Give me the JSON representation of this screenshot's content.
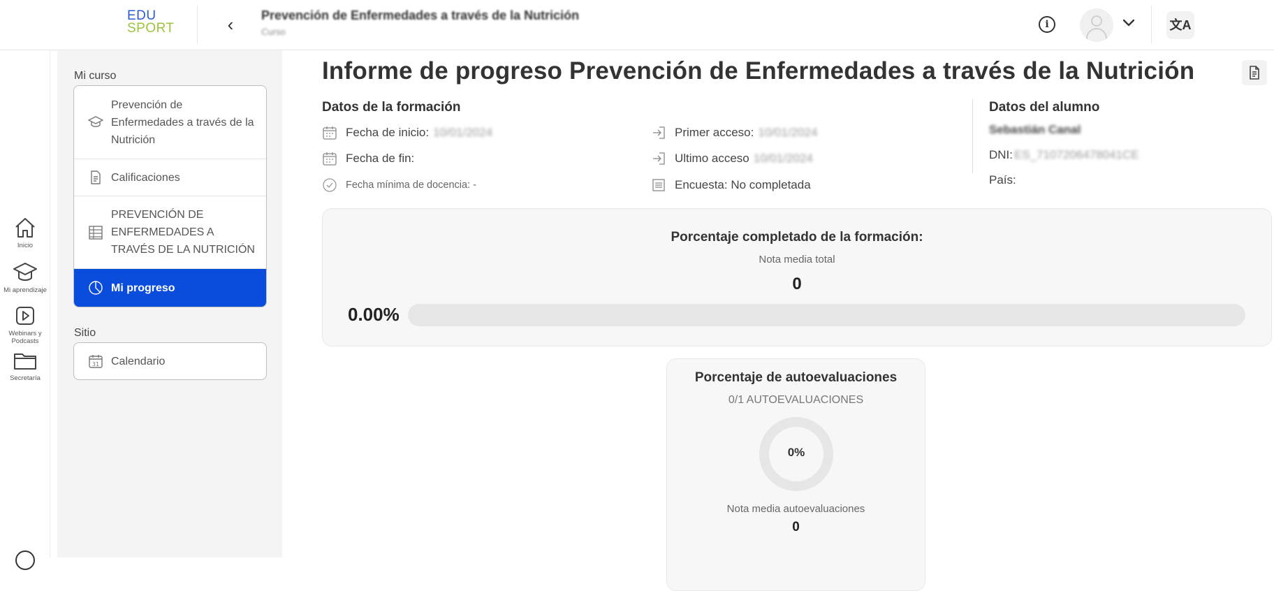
{
  "header": {
    "logo_line1": "EDU",
    "logo_line2": "SPORT",
    "course_title": "Prevención de Enfermedades a través de la Nutrición",
    "course_subtitle": "Curso",
    "info_icon": "info-icon",
    "avatar_icon": "user-avatar-icon",
    "menu_icon": "chevron-down-icon",
    "translate_icon": "translate-icon",
    "translate_glyph": "文A"
  },
  "left_nav": {
    "items": [
      {
        "label": "Inicio",
        "icon": "home-icon"
      },
      {
        "label": "Mi aprendizaje",
        "icon": "graduation-cap-icon"
      },
      {
        "label": "Webinars y Podcasts",
        "icon": "play-icon"
      },
      {
        "label": "Secretaría",
        "icon": "folder-icon"
      }
    ]
  },
  "sidebar": {
    "section1_label": "Mi curso",
    "section2_label": "Sitio",
    "course_items": [
      {
        "label": "Prevención de Enfermedades a través de la Nutrición",
        "icon": "graduation-cap-icon"
      },
      {
        "label": "Calificaciones",
        "icon": "document-icon"
      },
      {
        "label": "PREVENCIÓN DE ENFERMEDADES A TRAVÉS DE LA NUTRICIÓN",
        "icon": "grid-list-icon"
      },
      {
        "label": "Mi progreso",
        "icon": "pie-chart-icon",
        "active": true
      }
    ],
    "site_items": [
      {
        "label": "Calendario",
        "icon": "calendar-icon",
        "day": "31"
      }
    ]
  },
  "report": {
    "title": "Informe de progreso Prevención de Enfermedades a través de la Nutrición",
    "export_icon": "document-icon",
    "training_heading": "Datos de la formación",
    "start_label": "Fecha de inicio:",
    "start_value": "10/01/2024",
    "end_label": "Fecha de fin:",
    "min_label": "Fecha mínima de docencia: -",
    "first_access_label": "Primer acceso:",
    "first_access_value": "10/01/2024",
    "last_access_label": "Ultimo acceso",
    "last_access_value": "10/01/2024",
    "survey_label": "Encuesta: No completada",
    "student_heading": "Datos del alumno",
    "student_name": "Sebastián Canal",
    "dni_label": "DNI:",
    "dni_value": "ES_7107206478041CE",
    "country_label": "País:"
  },
  "completion": {
    "title": "Porcentaje completado de la formación:",
    "avg_label": "Nota media total",
    "avg_value": "0",
    "percent_text": "0.00%",
    "progress_fraction": 0,
    "bar_color": "#0a4ddc"
  },
  "selfeval": {
    "title": "Porcentaje de autoevaluaciones",
    "count_text": "0/1 AUTOEVALUACIONES",
    "donut_text": "0%",
    "donut_fraction": 0,
    "avg_label": "Nota media autoevaluaciones",
    "avg_value": "0"
  },
  "colors": {
    "accent": "#0a4ddc",
    "logo_blue": "#2a5bd7",
    "logo_green": "#9bc43b"
  }
}
